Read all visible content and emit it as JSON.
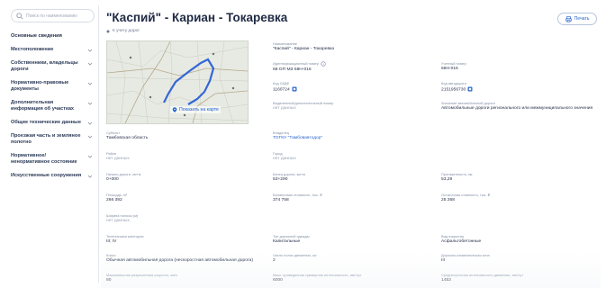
{
  "sidebar": {
    "search_placeholder": "Поиск по наименованию",
    "items": [
      {
        "label": "Основные сведения",
        "chevron": false
      },
      {
        "label": "Местоположение",
        "chevron": true
      },
      {
        "label": "Собственники, владельцы дороги",
        "chevron": true
      },
      {
        "label": "Нормативно-правовые документы",
        "chevron": true
      },
      {
        "label": "Дополнительная информация об участках",
        "chevron": true
      },
      {
        "label": "Общие технические данные",
        "chevron": true
      },
      {
        "label": "Проезжая часть и земляное полотно",
        "chevron": true
      },
      {
        "label": "Нормативное/ ненормативное состояние",
        "chevron": true
      },
      {
        "label": "Искусственные сооружения",
        "chevron": true
      }
    ]
  },
  "header": {
    "title": "\"Каспий\" - Кариан - Токаревка",
    "subtitle": "К учету дорог",
    "print_label": "Печать"
  },
  "map": {
    "show_label": "Показать на карте"
  },
  "fields": {
    "name_label": "Наименование",
    "name_value": "\"Каспий\" - Кариан - Токаревка",
    "ident_label": "Идентификационный номер",
    "ident_value": "68 ОП МЗ 68Н-016",
    "account_label": "Учетный номер",
    "account_value": "68Н-016",
    "ugdd_label": "Код СКДФ",
    "ugdd_value": "1160724",
    "asset_label": "Код автодороги",
    "asset_value": "2151956730",
    "extra_label": "Выделенный/дополнительный номер",
    "extra_value": "нет данных",
    "class_label": "Значение автомобильной дороги",
    "class_value": "Автомобильные дороги регионального или межмуниципального значения",
    "subject_label": "Субъект",
    "subject_value": "Тамбовская область",
    "owner_label": "Владелец",
    "owner_value": "ТОГКУ \"Тамбовавтодор\"",
    "district_label": "Район",
    "district_value": "нет данных",
    "city_label": "Город",
    "city_value": "нет данных",
    "start_label": "Начало дороги, км+м",
    "start_value": "0+000",
    "end_label": "Конец дороги, км+м",
    "end_value": "53+290",
    "length_label": "Протяженность, км",
    "length_value": "53,29",
    "area_label": "Площадь, м²",
    "area_value": "266 392",
    "balance_label": "Балансовая стоимость, тыс. ₽",
    "balance_value": "374 758",
    "residual_label": "Остаточная стоимость, тыс. ₽",
    "residual_value": "25 268",
    "width_label": "Ширина полосы (м)",
    "width_value": "нет данных",
    "category_label": "Техническая категория",
    "category_value": "III; IV",
    "surface_label": "Тип дорожной одежды",
    "surface_value": "Капитальные",
    "cover_label": "Вид покрытия",
    "cover_value": "Асфальтобетонные",
    "type_label": "Класс",
    "type_value": "Обычная автомобильная дорога (нескоростная автомобильная дорога)",
    "lanes_label": "Число полос движения, шт.",
    "lanes_value": "2",
    "zone_label": "Дорожно-климатическая зона",
    "zone_value": "III",
    "speed_label": "Максимальная разрешенная скорость, км/ч",
    "speed_value": "80",
    "intensity_label": "Макс. приведенная суммарная интенсивность, авт/сут",
    "intensity_value": "6000",
    "avg_label": "Среднесуточная интенсивность движения, авт/сут",
    "avg_value": "1453"
  },
  "colors": {
    "accent": "#2a66d0",
    "title": "#1f2a44",
    "label": "#8390a6"
  }
}
